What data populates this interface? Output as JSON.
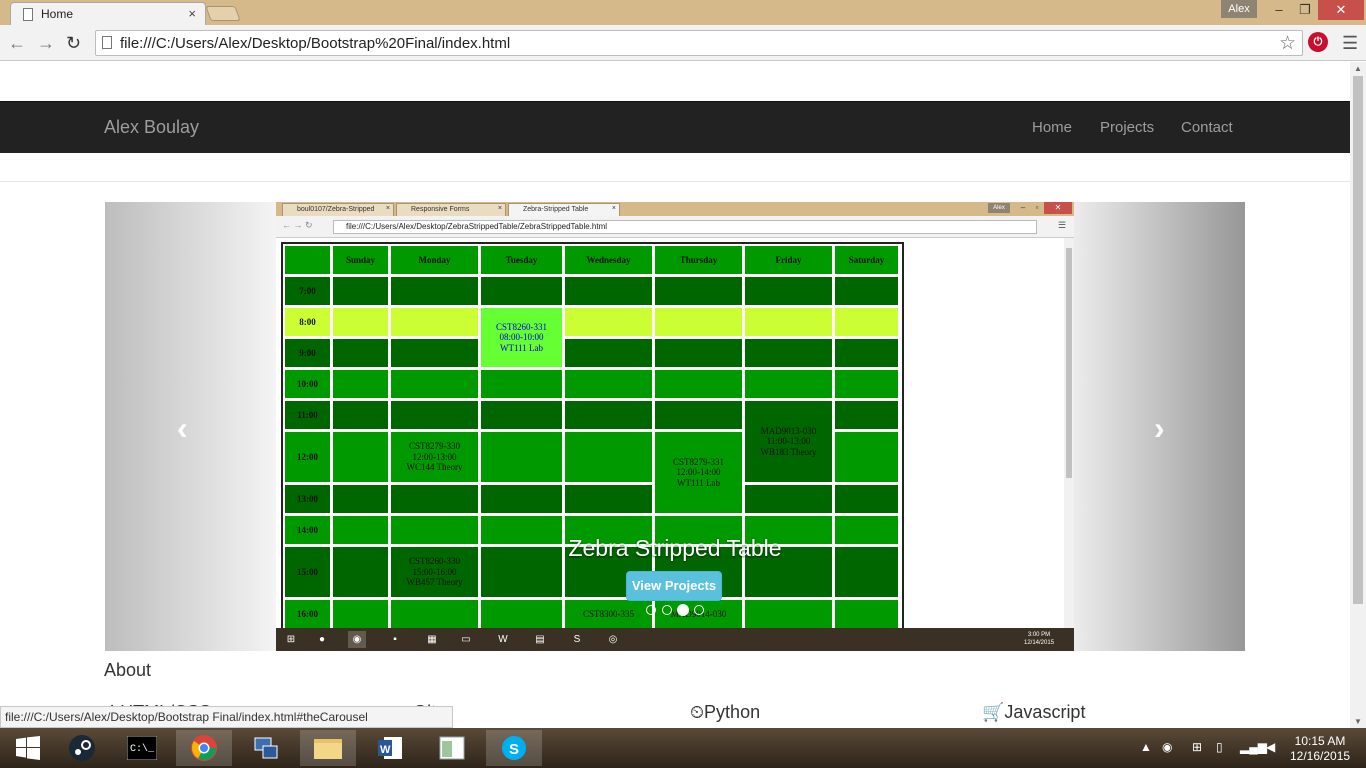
{
  "browser": {
    "tab_title": "Home",
    "tab_close": "×",
    "user": "Alex",
    "min": "–",
    "restore": "❐",
    "close": "✕",
    "url": "file:///C:/Users/Alex/Desktop/Bootstrap%20Final/index.html",
    "back": "←",
    "forward": "→",
    "reload": "↻",
    "star": "☆",
    "ext": "⏻",
    "menu": "☰"
  },
  "nav": {
    "brand": "Alex Boulay",
    "links": [
      "Home",
      "Projects",
      "Contact"
    ]
  },
  "carousel": {
    "caption": "Zebra Stripped Table",
    "button": "View Projects",
    "prev": "‹",
    "next": "›",
    "indicators": 4,
    "active_index": 2
  },
  "inner_shot": {
    "tabs": [
      "boul0107/Zebra-Stripped",
      "Responsive Forms",
      "Zebra-Stripped Table"
    ],
    "url": "file:///C:/Users/Alex/Desktop/ZebraStrippedTable/ZebraStrippedTable.html",
    "user": "Alex",
    "clock_time": "3:00 PM",
    "clock_date": "12/14/2015",
    "table": {
      "days": [
        "Sunday",
        "Monday",
        "Tuesday",
        "Wednesday",
        "Thursday",
        "Friday",
        "Saturday"
      ],
      "times": [
        "7:00",
        "8:00",
        "9:00",
        "10:00",
        "11:00",
        "12:00",
        "13:00",
        "14:00",
        "15:00",
        "16:00"
      ],
      "events": {
        "tue_8": "CST8260-331\n08:00-10:00\nWT111 Lab",
        "mon_12": "CST8279-330\n12:00-13:00\nWC144 Theory",
        "thu_12": "CST8279-331\n12:00-14:00\nWT111 Lab",
        "fri_11": "MAD9013-030\n11:00-13:00\nWB183 Theory",
        "mon_15": "CST8260-330\n15:00-16:00\nWB457 Theory",
        "wed_16": "CST8300-335",
        "thu_16": "MAD9014-030"
      }
    }
  },
  "about": {
    "title": "About",
    "skills": [
      {
        "icon": "⚙",
        "label": "HTML/CSS"
      },
      {
        "icon": "⊙",
        "label": "Git"
      },
      {
        "icon": "⏲",
        "label": "Python"
      },
      {
        "icon": "🛒",
        "label": "Javascript"
      }
    ]
  },
  "statusbar": "file:///C:/Users/Alex/Desktop/Bootstrap Final/index.html#theCarousel",
  "taskbar": {
    "time": "10:15 AM",
    "date": "12/16/2015"
  },
  "colors": {
    "dark_green": "#006600",
    "green": "#009900",
    "lime_row": "#ccff33",
    "highlight": "#66ff33",
    "btn_info": "#5bc0de"
  }
}
